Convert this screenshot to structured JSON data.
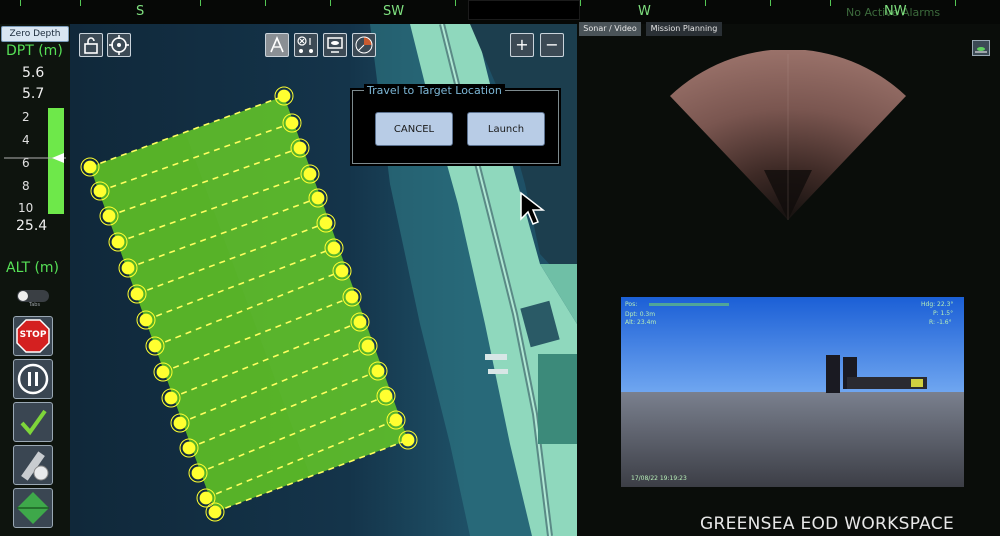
{
  "compass": {
    "directions": [
      "S",
      "SW",
      "W",
      "NW"
    ],
    "alarms": "No Active Alarms"
  },
  "left_panel": {
    "zero_depth": "Zero Depth",
    "depth_label": "DPT (m)",
    "depth_value_1": "5.6",
    "depth_value_2": "5.7",
    "depth_scale": [
      "2",
      "4",
      "6",
      "8",
      "10"
    ],
    "depth_max": "25.4",
    "alt_label": "ALT (m)",
    "toggle_label": "Tabs",
    "stop_label": "STOP"
  },
  "map": {
    "dialog_title": "Travel to Target Location",
    "cancel_label": "CANCEL",
    "launch_label": "Launch",
    "zoom_in": "+",
    "zoom_out": "−"
  },
  "right_panel": {
    "tabs": [
      "Sonar / Video",
      "Mission Planning"
    ],
    "video": {
      "pos_label": "Pos:",
      "dpt": "Dpt: 0.3m",
      "alt": "Alt: 23.4m",
      "hdg": "Hdg: 22.3°",
      "pitch": "P: 1.5°",
      "roll": "R: -1.6°",
      "timestamp": "17/08/22 19:19:23"
    },
    "workspace_label": "GREENSEA EOD WORKSPACE"
  },
  "colors": {
    "accent_green": "#56e056",
    "survey_fill": "#5fbf2a",
    "waypoint": "#ffff30",
    "dialog_button": "#b8cce6"
  },
  "icons": [
    "unlock-icon",
    "target-icon",
    "nav-a-icon",
    "waypoint-mode-icon",
    "monitor-icon",
    "radar-icon",
    "pause-icon",
    "check-icon",
    "ruler-icon",
    "waypoint-diamond-icon",
    "mouse-cursor-icon",
    "collapse-icon"
  ]
}
